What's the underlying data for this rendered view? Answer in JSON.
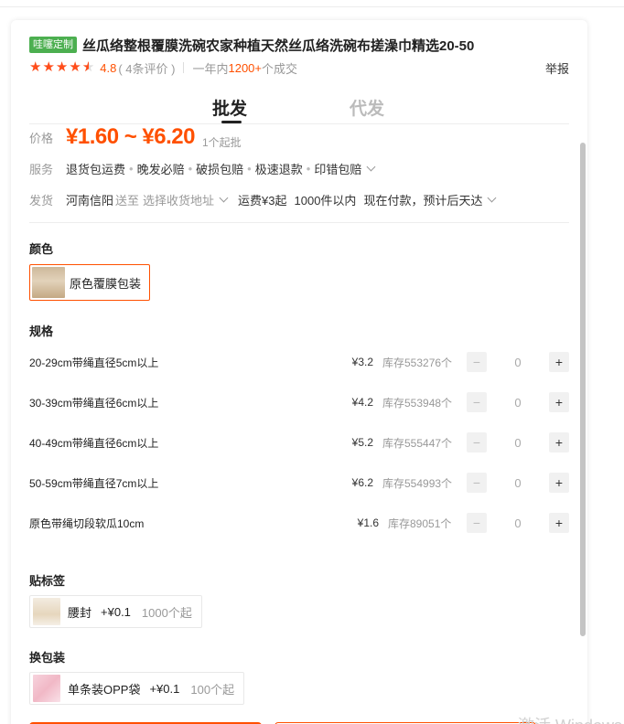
{
  "product": {
    "badge": "哇噻定制",
    "title": "丝瓜络整根覆膜洗碗农家种植天然丝瓜络洗碗布搓澡巾精选20-50",
    "rating_value": 4.5,
    "score": "4.8",
    "reviews": "( 4条评价 )",
    "sales_prefix": "一年内",
    "sales_count": "1200+",
    "sales_suffix": " 个成交",
    "report": "举报"
  },
  "tabs": [
    {
      "label": "批发",
      "active": true
    },
    {
      "label": "代发",
      "active": false
    }
  ],
  "price": {
    "label": "价格",
    "range": "¥1.60 ~ ¥6.20",
    "min_order": "1个起批"
  },
  "service": {
    "label": "服务",
    "items": [
      "退货包运费",
      "晚发必赔",
      "破损包赔",
      "极速退款",
      "印错包赔"
    ]
  },
  "shipping": {
    "label": "发货",
    "origin": "河南信阳",
    "to": "送至",
    "address_placeholder": "选择收货地址",
    "fee": "运费¥3起",
    "qty": "1000件以内",
    "lead_time": "现在付款，预计后天达"
  },
  "color": {
    "title": "颜色",
    "options": [
      {
        "label": "原色覆膜包装",
        "selected": true
      }
    ]
  },
  "specs": {
    "title": "规格",
    "rows": [
      {
        "name": "20-29cm带绳直径5cm以上",
        "price": "¥3.2",
        "stock": "库存553276个",
        "qty": "0"
      },
      {
        "name": "30-39cm带绳直径6cm以上",
        "price": "¥4.2",
        "stock": "库存553948个",
        "qty": "0"
      },
      {
        "name": "40-49cm带绳直径6cm以上",
        "price": "¥5.2",
        "stock": "库存555447个",
        "qty": "0"
      },
      {
        "name": "50-59cm带绳直径7cm以上",
        "price": "¥6.2",
        "stock": "库存554993个",
        "qty": "0"
      },
      {
        "name": "原色带绳切段软瓜10cm",
        "price": "¥1.6",
        "stock": "库存89051个",
        "qty": "0"
      }
    ]
  },
  "label_section": {
    "title": "贴标签",
    "name": "腰封",
    "price": "+¥0.1",
    "min": "1000个起"
  },
  "packaging_section": {
    "title": "换包装",
    "name": "单条装OPP袋",
    "price": "+¥0.1",
    "min": "100个起"
  },
  "icons": {
    "minus": "−",
    "plus": "+",
    "star": "★"
  },
  "colors": {
    "accent": "#ff5000",
    "badge": "#4caf50"
  },
  "watermark": "激活 Windows"
}
